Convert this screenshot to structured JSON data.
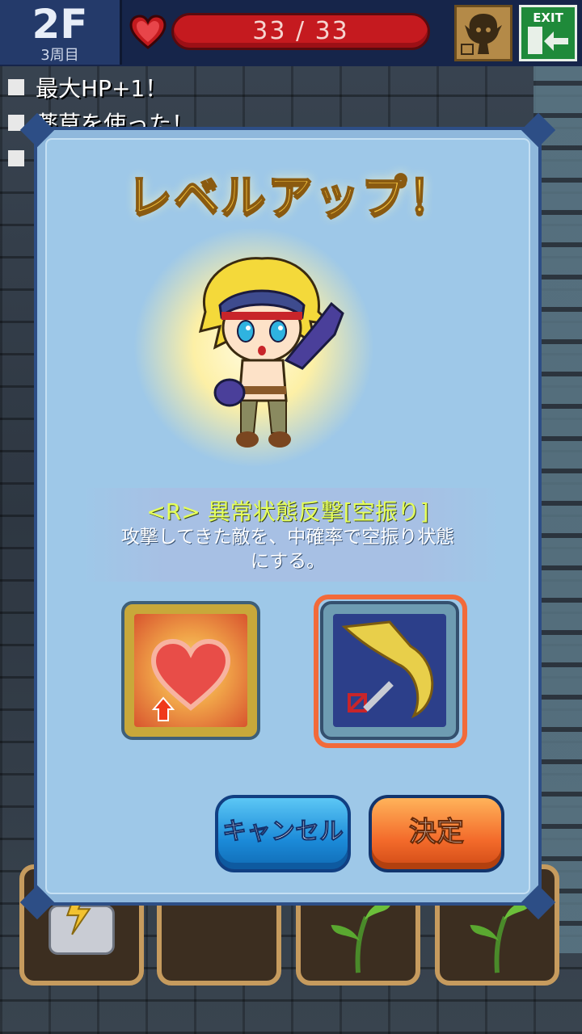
{
  "hud": {
    "floor": "2F",
    "lap": "3周目",
    "hp_current": 33,
    "hp_max": 33,
    "hp_text": "33  /  33",
    "exit_label": "EXIT"
  },
  "log": [
    {
      "text": "最大HP+1！"
    },
    {
      "text": "薬草を使った！"
    },
    {
      "text": ""
    }
  ],
  "dialog": {
    "title": "レベルアップ！",
    "skill_title": "<R> 異常状態反撃[空振り]",
    "skill_desc": "攻撃してきた敵を、中確率で空振り状態にする。",
    "choices": [
      {
        "icon": "heart-up-icon",
        "selected": false
      },
      {
        "icon": "whirlwind-skill-icon",
        "selected": true
      }
    ],
    "cancel_label": "キャンセル",
    "ok_label": "決定"
  },
  "inventory": [
    {
      "icon": "scroll-icon"
    },
    {
      "icon": "empty-slot"
    },
    {
      "icon": "herb-icon"
    },
    {
      "icon": "herb-icon"
    }
  ],
  "colors": {
    "hp_bar": "#c51a1f",
    "title_gold": "#f5c542",
    "skill_title": "#e6ff5a",
    "selected_border": "#f26a3a"
  }
}
